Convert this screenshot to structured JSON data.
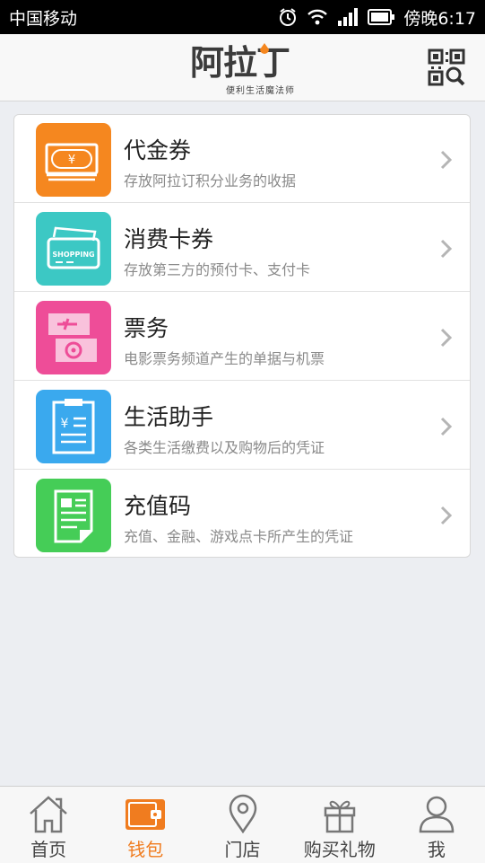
{
  "status": {
    "carrier": "中国移动",
    "time": "傍晚6:17",
    "icons": [
      "alarm-icon",
      "wifi-icon",
      "signal-icon",
      "battery-icon"
    ]
  },
  "header": {
    "logo_text": "阿拉丁",
    "logo_sub": "便利生活魔法师",
    "qr_icon": "qr-scan-icon"
  },
  "wallet": {
    "items": [
      {
        "title": "代金券",
        "subtitle": "存放阿拉订积分业务的收据",
        "icon": "voucher-icon",
        "color": "#f5871f"
      },
      {
        "title": "消费卡券",
        "subtitle": "存放第三方的预付卡、支付卡",
        "icon": "shopping-card-icon",
        "color": "#3cc8c4"
      },
      {
        "title": "票务",
        "subtitle": "电影票务频道产生的单据与机票",
        "icon": "ticket-icon",
        "color": "#ee4d98"
      },
      {
        "title": "生活助手",
        "subtitle": "各类生活缴费以及购物后的凭证",
        "icon": "bill-clipboard-icon",
        "color": "#3aa9ee"
      },
      {
        "title": "充值码",
        "subtitle": "充值、金融、游戏点卡所产生的凭证",
        "icon": "recharge-doc-icon",
        "color": "#45cd57"
      }
    ]
  },
  "tabs": [
    {
      "label": "首页",
      "icon": "home-icon",
      "active": false
    },
    {
      "label": "钱包",
      "icon": "wallet-icon",
      "active": true
    },
    {
      "label": "门店",
      "icon": "location-pin-icon",
      "active": false
    },
    {
      "label": "购买礼物",
      "icon": "gift-icon",
      "active": false
    },
    {
      "label": "我",
      "icon": "user-icon",
      "active": false
    }
  ],
  "colors": {
    "accent": "#f07c1f",
    "background": "#eceef2"
  }
}
